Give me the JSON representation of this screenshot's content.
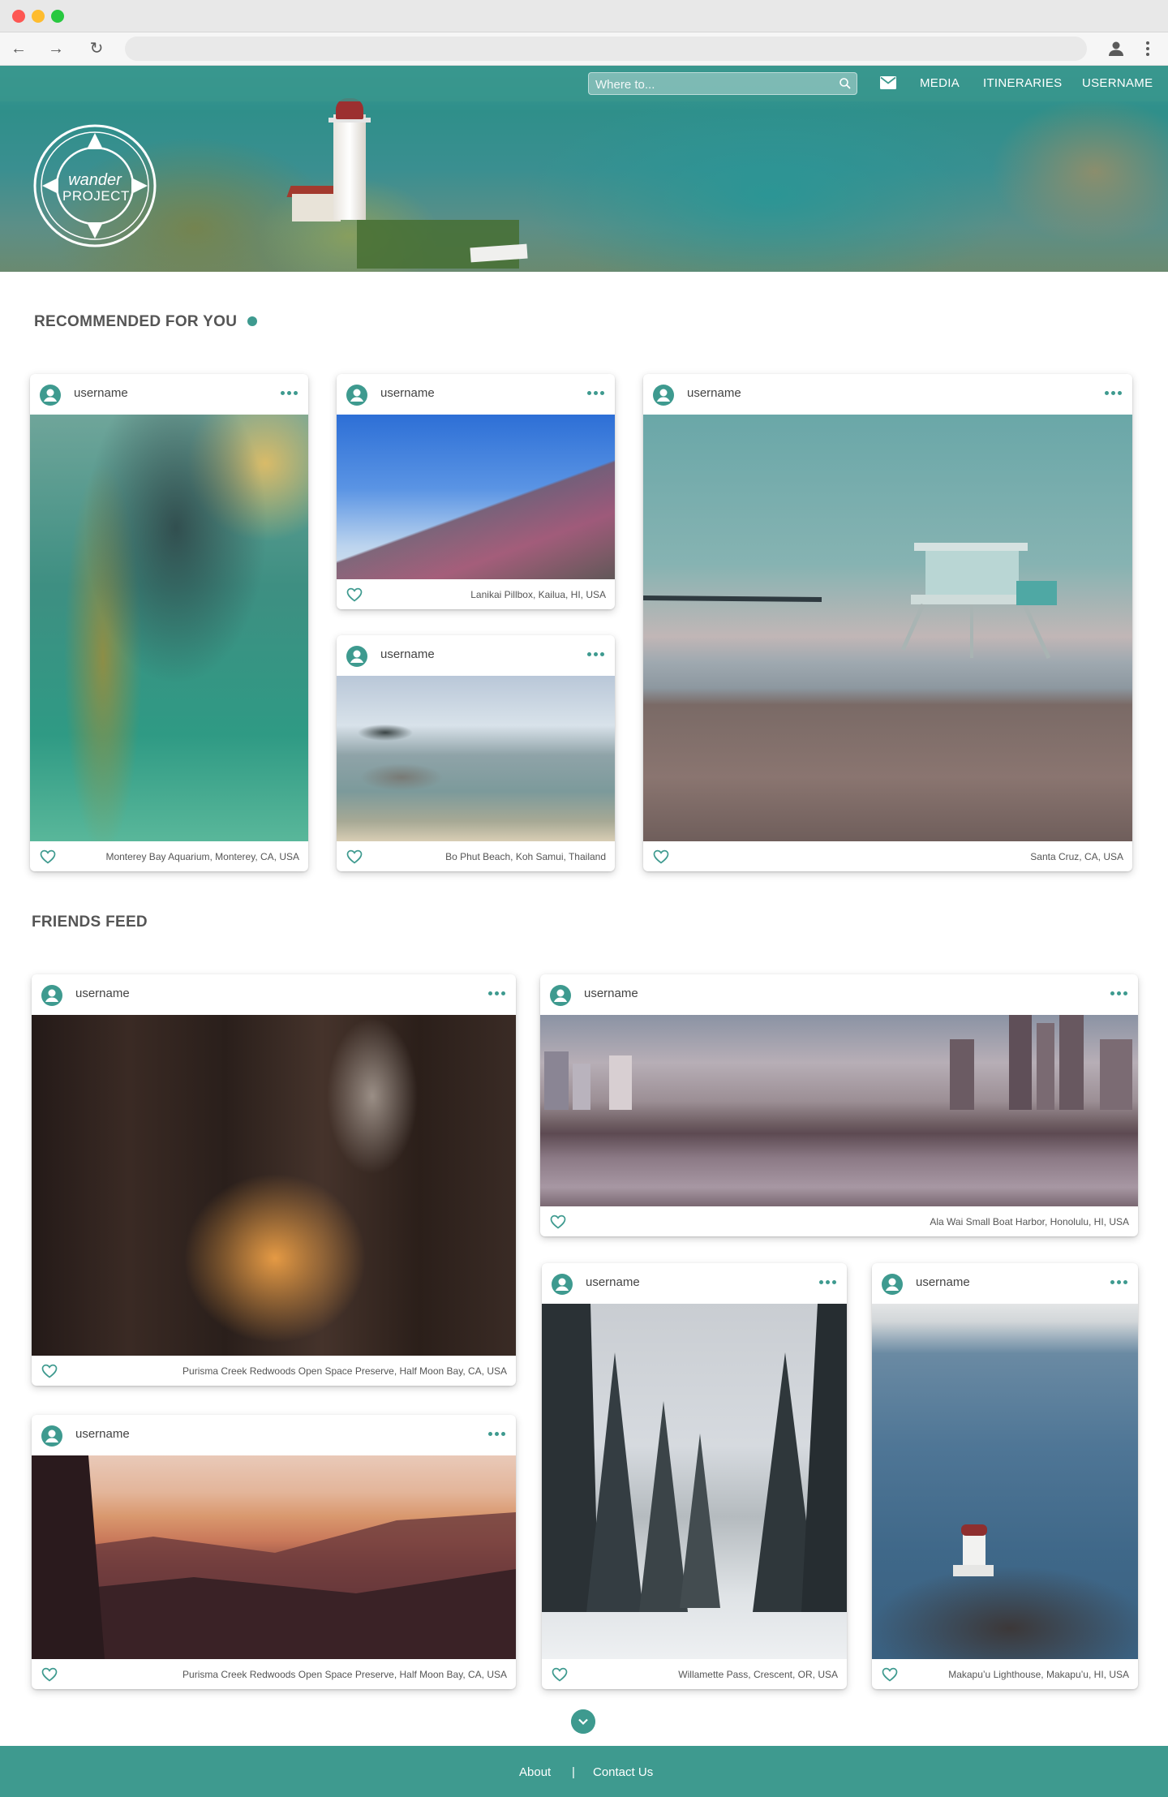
{
  "browser": {
    "back_glyph": "←",
    "forward_glyph": "→",
    "reload_glyph": "↻",
    "url": ""
  },
  "header": {
    "search_placeholder": "Where to...",
    "nav": {
      "media": "MEDIA",
      "itineraries": "ITINERARIES",
      "username": "USERNAME"
    },
    "logo": {
      "line1": "wander",
      "line2": "PROJECT"
    }
  },
  "recommended": {
    "title": "RECOMMENDED FOR YOU",
    "cards": [
      {
        "username": "username",
        "location": "Monterey Bay Aquarium, Monterey, CA, USA"
      },
      {
        "username": "username",
        "location": "Lanikai Pillbox, Kailua, HI, USA"
      },
      {
        "username": "username",
        "location": "Bo Phut Beach, Koh Samui, Thailand"
      },
      {
        "username": "username",
        "location": "Santa Cruz, CA, USA"
      }
    ]
  },
  "friends_feed": {
    "title": "FRIENDS FEED",
    "cards": [
      {
        "username": "username",
        "location": "Purisma Creek Redwoods Open Space Preserve, Half Moon Bay, CA, USA"
      },
      {
        "username": "username",
        "location": "Ala Wai Small Boat Harbor, Honolulu, HI, USA"
      },
      {
        "username": "username",
        "location": "Willamette Pass, Crescent, OR, USA"
      },
      {
        "username": "username",
        "location": "Makapu’u Lighthouse, Makapu’u, HI, USA"
      },
      {
        "username": "username",
        "location": "Purisma Creek Redwoods Open Space Preserve, Half Moon Bay, CA, USA"
      }
    ]
  },
  "footer": {
    "about": "About",
    "separator": "|",
    "contact": "Contact Us"
  },
  "colors": {
    "accent": "#3e9a8f",
    "footer_bg": "#3e9a8f",
    "chrome_bg": "#e8e8e8"
  }
}
